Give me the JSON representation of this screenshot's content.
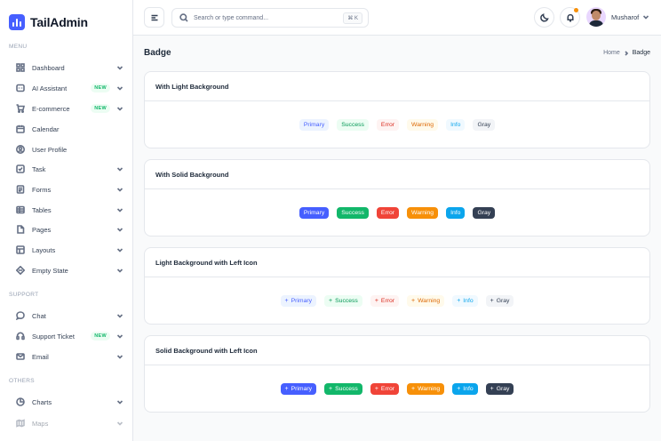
{
  "brand": {
    "name": "TailAdmin"
  },
  "sidebar": {
    "sections": [
      {
        "label": "MENU"
      },
      {
        "label": "SUPPORT"
      },
      {
        "label": "OTHERS"
      }
    ],
    "items": [
      {
        "label": "Dashboard",
        "icon": "grid-icon",
        "badge": "",
        "chevron": true
      },
      {
        "label": "AI Assistant",
        "icon": "ai-icon",
        "badge": "NEW",
        "chevron": true
      },
      {
        "label": "E-commerce",
        "icon": "cart-icon",
        "badge": "NEW",
        "chevron": true
      },
      {
        "label": "Calendar",
        "icon": "calendar-icon",
        "badge": "",
        "chevron": false
      },
      {
        "label": "User Profile",
        "icon": "user-circle-icon",
        "badge": "",
        "chevron": false
      },
      {
        "label": "Task",
        "icon": "task-icon",
        "badge": "",
        "chevron": true
      },
      {
        "label": "Forms",
        "icon": "forms-icon",
        "badge": "",
        "chevron": true
      },
      {
        "label": "Tables",
        "icon": "table-icon",
        "badge": "",
        "chevron": true
      },
      {
        "label": "Pages",
        "icon": "pages-icon",
        "badge": "",
        "chevron": true
      },
      {
        "label": "Layouts",
        "icon": "layouts-icon",
        "badge": "",
        "chevron": true
      },
      {
        "label": "Empty State",
        "icon": "empty-state-icon",
        "badge": "",
        "chevron": true
      },
      {
        "label": "Chat",
        "icon": "chat-icon",
        "badge": "",
        "chevron": true
      },
      {
        "label": "Support Ticket",
        "icon": "headset-icon",
        "badge": "NEW",
        "chevron": true
      },
      {
        "label": "Email",
        "icon": "mail-icon",
        "badge": "",
        "chevron": true
      },
      {
        "label": "Charts",
        "icon": "pie-chart-icon",
        "badge": "",
        "chevron": true
      },
      {
        "label": "Maps",
        "icon": "map-icon",
        "badge": "",
        "chevron": true
      }
    ]
  },
  "header": {
    "search_placeholder": "Search or type command...",
    "shortcut": "⌘ K",
    "user_name": "Musharof"
  },
  "page": {
    "title": "Badge",
    "breadcrumb": {
      "home": "Home",
      "current": "Badge"
    }
  },
  "cards": [
    {
      "title": "With Light Background",
      "style": "light",
      "icon": false
    },
    {
      "title": "With Solid Background",
      "style": "solid",
      "icon": false
    },
    {
      "title": "Light Background with Left Icon",
      "style": "light",
      "icon": true
    },
    {
      "title": "Solid Background with Left Icon",
      "style": "solid",
      "icon": true
    }
  ],
  "badges": [
    "Primary",
    "Success",
    "Error",
    "Warning",
    "Info",
    "Gray"
  ],
  "colors": {
    "primary": "#465fff",
    "success": "#12b76a",
    "error": "#f04438",
    "warning": "#f79009",
    "info": "#0ba5ec",
    "gray": "#344054"
  }
}
